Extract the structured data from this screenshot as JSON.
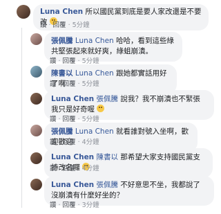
{
  "comments": [
    {
      "author": "Luna Chen",
      "text": "所以國民黨到底是要人家改還是不要改",
      "emoji": "smile-emoji",
      "actions": [
        "讚",
        "回覆"
      ],
      "time": "5分鐘"
    },
    {
      "author": "張佩騰",
      "mention": "Luna Chen",
      "text": "哈哈，看到這些綠共堅張起來就好爽，綠蛆崩潰。",
      "actions": [
        "讚",
        "回覆"
      ],
      "time": "5分鐘"
    },
    {
      "author": "陳書以",
      "mention": "Luna Chen",
      "text": "跟她都實話用好了啊",
      "actions": [
        "讚",
        "回覆"
      ],
      "time": "5分鐘"
    },
    {
      "author": "Luna Chen",
      "mention": "張佩騰",
      "text": "說我？我不崩潰也不緊張我只是好奇喔",
      "emoji": "smile-emoji",
      "actions": [
        "讚",
        "回覆"
      ],
      "time": "5分鐘"
    },
    {
      "author": "張佩騰",
      "mention": "Luna Chen",
      "text": "就看誰對號入坐啊，歡迎歡迎",
      "actions": [
        "讚",
        "回覆"
      ],
      "time": "4分鐘"
    },
    {
      "author": "Luna Chen",
      "mention": "陳書以",
      "text": "那希望大家支持國民黨支持改名囉",
      "emoji": "smile-emoji",
      "actions": [
        "讚",
        "回覆"
      ],
      "time": "4分鐘"
    },
    {
      "author": "Luna Chen",
      "mention": "張佩騰",
      "text": "不好意思不坐，我都說了沒崩潰有什麼好坐的？",
      "actions": [
        "讚",
        "回覆"
      ],
      "time": "3分鐘"
    }
  ],
  "colors": {
    "link": "#385898",
    "bubble": "#f2f3f5",
    "meta": "#90949c"
  }
}
